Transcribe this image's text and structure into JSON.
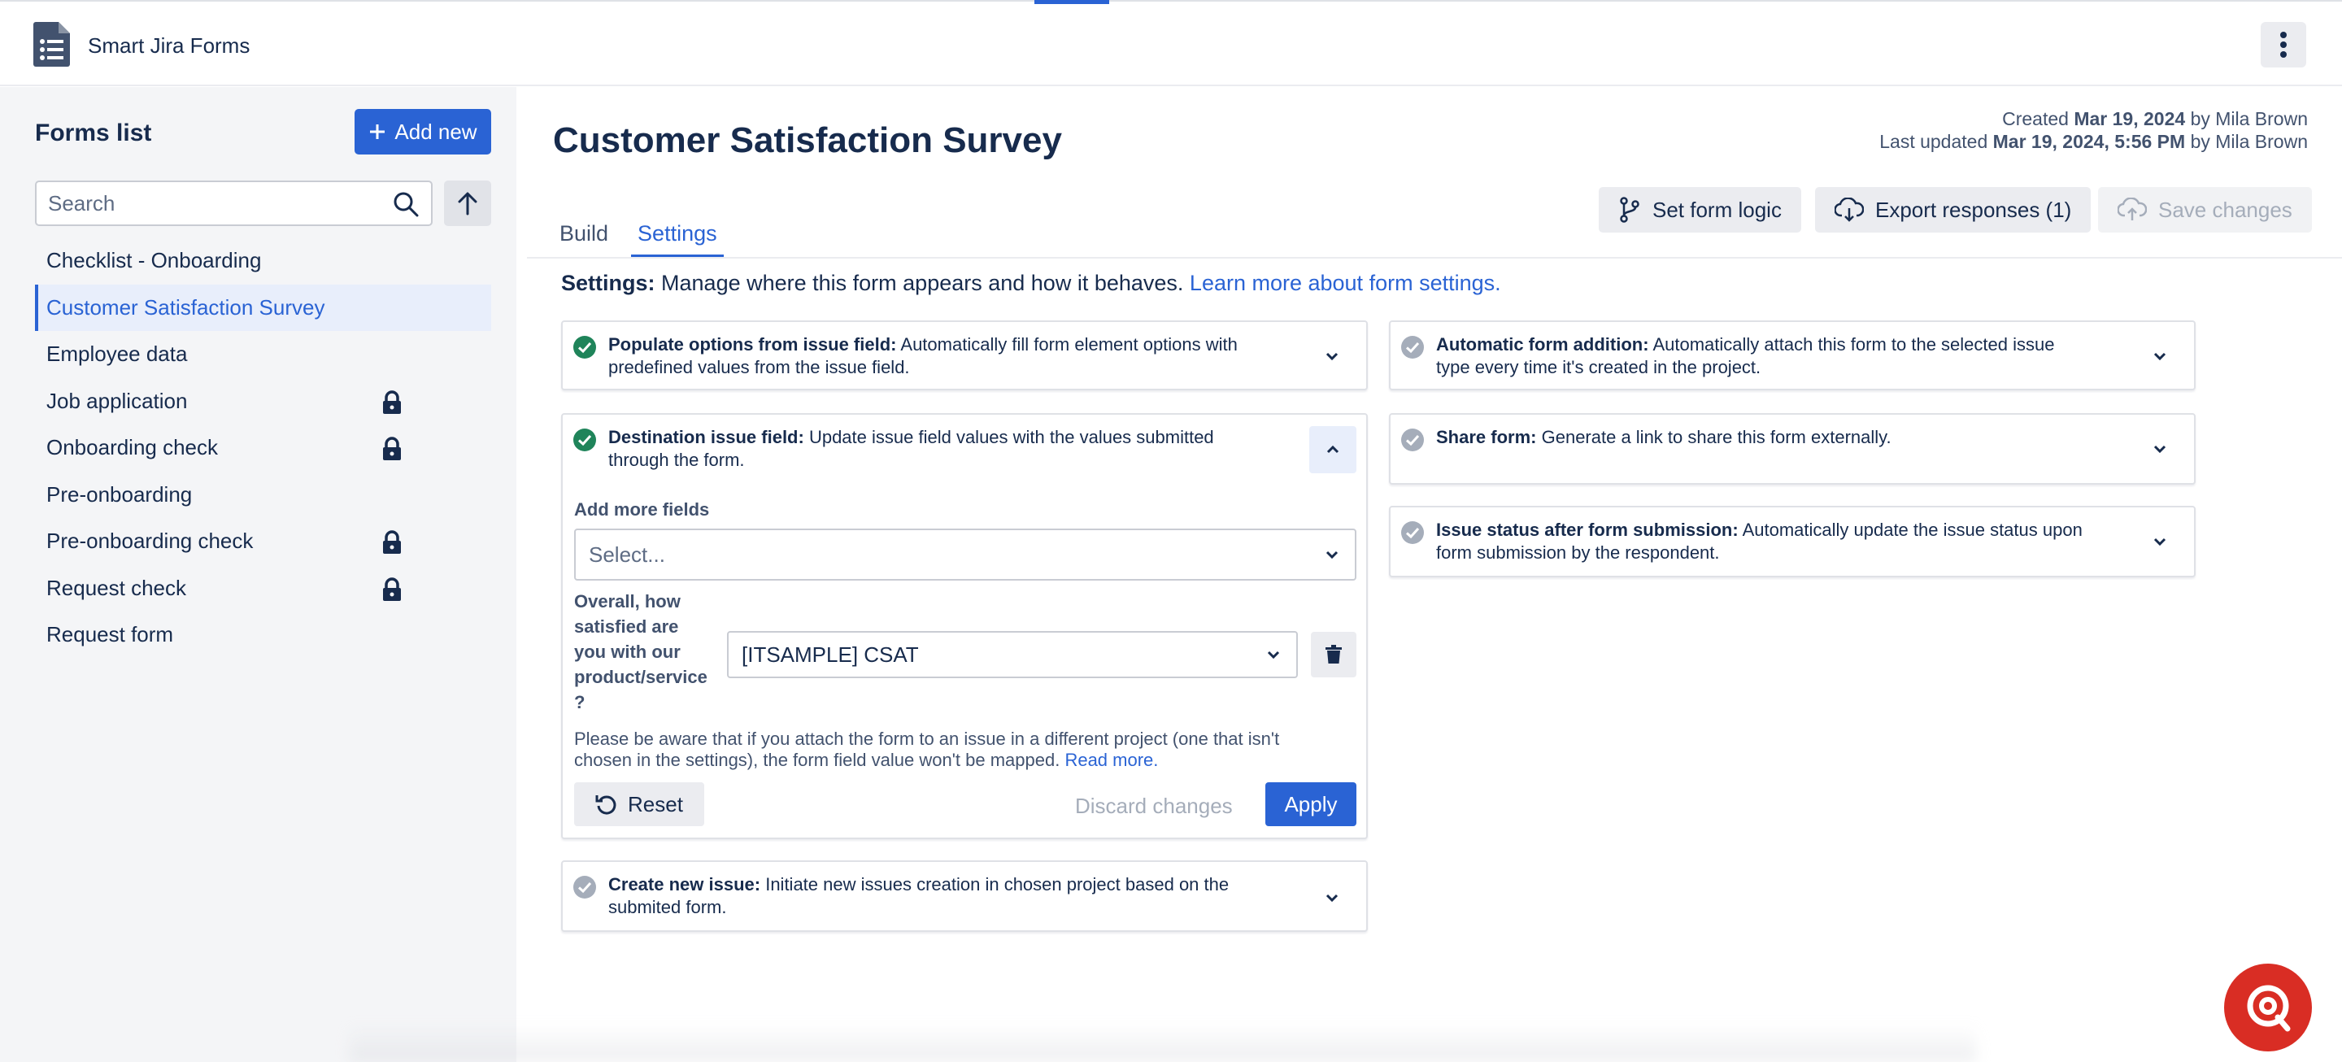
{
  "app": {
    "name": "Smart Jira Forms"
  },
  "sidebar": {
    "title": "Forms list",
    "add_new_label": "Add new",
    "search_placeholder": "Search",
    "items": [
      {
        "label": "Checklist - Onboarding",
        "locked": false,
        "active": false
      },
      {
        "label": "Customer Satisfaction Survey",
        "locked": false,
        "active": true
      },
      {
        "label": "Employee data",
        "locked": false,
        "active": false
      },
      {
        "label": "Job application",
        "locked": true,
        "active": false
      },
      {
        "label": "Onboarding check",
        "locked": true,
        "active": false
      },
      {
        "label": "Pre-onboarding",
        "locked": false,
        "active": false
      },
      {
        "label": "Pre-onboarding check",
        "locked": true,
        "active": false
      },
      {
        "label": "Request check",
        "locked": true,
        "active": false
      },
      {
        "label": "Request form",
        "locked": false,
        "active": false
      }
    ]
  },
  "main": {
    "title": "Customer Satisfaction Survey",
    "meta": {
      "created_prefix": "Created",
      "created_date": "Mar 19, 2024",
      "created_by": "by Mila Brown",
      "updated_prefix": "Last updated",
      "updated_date": "Mar 19, 2024, 5:56 PM",
      "updated_by": "by Mila Brown"
    },
    "tabs": [
      {
        "label": "Build",
        "active": false
      },
      {
        "label": "Settings",
        "active": true
      }
    ],
    "actions": {
      "set_logic": "Set form logic",
      "export": "Export responses (1)",
      "save": "Save changes"
    },
    "settings_intro": {
      "bold": "Settings:",
      "text": "Manage where this form appears and how it behaves.",
      "link": "Learn more about form settings."
    }
  },
  "cards": {
    "populate": {
      "title": "Populate options from issue field:",
      "desc_1": "Automatically fill form element options with",
      "desc_2": "predefined values from the issue field."
    },
    "destination": {
      "title": "Destination issue field:",
      "desc_1": "Update issue field values with the values submitted",
      "desc_2": "through the form.",
      "add_more_label": "Add more fields",
      "select_placeholder": "Select...",
      "question_label": "Overall, how satisfied are you with our product/service ?",
      "mapped_value": "[ITSAMPLE] CSAT",
      "notice_1": "Please be aware that if you attach the form to an issue in a different project (one that isn't",
      "notice_2": "chosen in the settings), the form field value won't be mapped.",
      "notice_link": "Read more.",
      "reset_label": "Reset",
      "discard_label": "Discard changes",
      "apply_label": "Apply"
    },
    "create_issue": {
      "title": "Create new issue:",
      "desc_1": "Initiate new issues creation in chosen project based on the",
      "desc_2": "submited form."
    },
    "auto_add": {
      "title": "Automatic form addition:",
      "desc_1": "Automatically attach this form to the selected issue",
      "desc_2": "type every time it's created in the project."
    },
    "share": {
      "title": "Share form:",
      "desc_1": "Generate a link to share this form externally."
    },
    "status": {
      "title": "Issue status after form submission:",
      "desc_1": "Automatically update the issue status upon",
      "desc_2": "form submission by the respondent."
    }
  },
  "colors": {
    "accent": "#2a63d4",
    "check_green": "#1f845a",
    "check_gray": "#a5adba",
    "chat": "#d92d24"
  }
}
